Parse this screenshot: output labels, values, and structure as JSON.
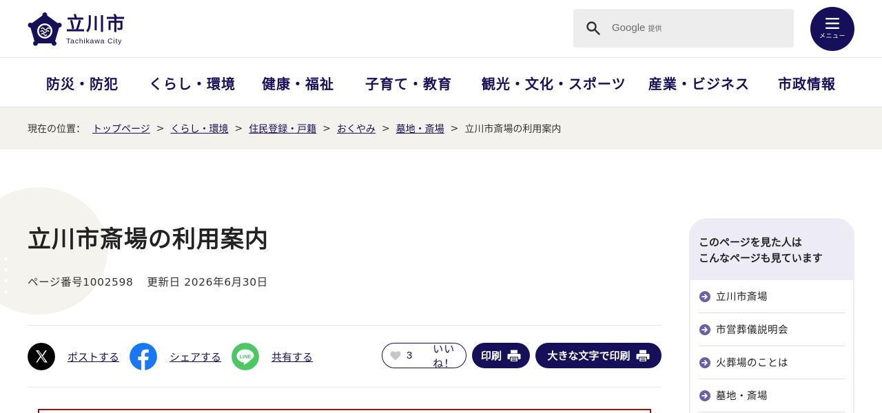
{
  "header": {
    "logo_name": "立川市",
    "logo_roman": "Tachikawa City",
    "search": {
      "placeholder": "",
      "google_label": "Google",
      "provided_label": "提供"
    },
    "menu_label": "メニュー"
  },
  "nav": {
    "items": [
      {
        "label": "防災・防犯"
      },
      {
        "label": "くらし・環境"
      },
      {
        "label": "健康・福祉"
      },
      {
        "label": "子育て・教育"
      },
      {
        "label": "観光・文化・スポーツ"
      },
      {
        "label": "産業・ビジネス"
      },
      {
        "label": "市政情報"
      }
    ]
  },
  "breadcrumb": {
    "prefix": "現在の位置：",
    "links": [
      "トップページ",
      "くらし・環境",
      "住民登録・戸籍",
      "おくやみ",
      "墓地・斎場"
    ],
    "separator": ">",
    "current": "立川市斎場の利用案内"
  },
  "page": {
    "title": "立川市斎場の利用案内",
    "page_number": "ページ番号1002598",
    "updated": "更新日 2026年6月30日"
  },
  "share": {
    "x_label": "ポストする",
    "facebook_label": "シェアする",
    "line_label": "共有する",
    "line_icon_text": "LINE"
  },
  "actions": {
    "like_count": "3",
    "like_label": "いいね！",
    "print_label": "印刷",
    "print_large_label": "大きな文字で印刷"
  },
  "sidebar": {
    "title_line1": "このページを見た人は",
    "title_line2": "こんなページも見ています",
    "items": [
      {
        "label": "立川市斎場"
      },
      {
        "label": "市営葬儀説明会"
      },
      {
        "label": "火葬場のことは"
      },
      {
        "label": "墓地・斎場"
      }
    ]
  },
  "colors": {
    "brand_navy": "#16105a",
    "breadcrumb_bg": "#f3f2ed",
    "sidebar_head_bg": "#edecf6",
    "facebook_blue": "#1877f2",
    "line_green": "#4cc764",
    "content_border": "#8a1a1a"
  },
  "icons": [
    "city-emblem-icon",
    "search-icon",
    "hamburger-icon",
    "x-logo-icon",
    "facebook-logo-icon",
    "line-logo-icon",
    "heart-icon",
    "printer-icon",
    "arrow-right-circle-icon"
  ]
}
